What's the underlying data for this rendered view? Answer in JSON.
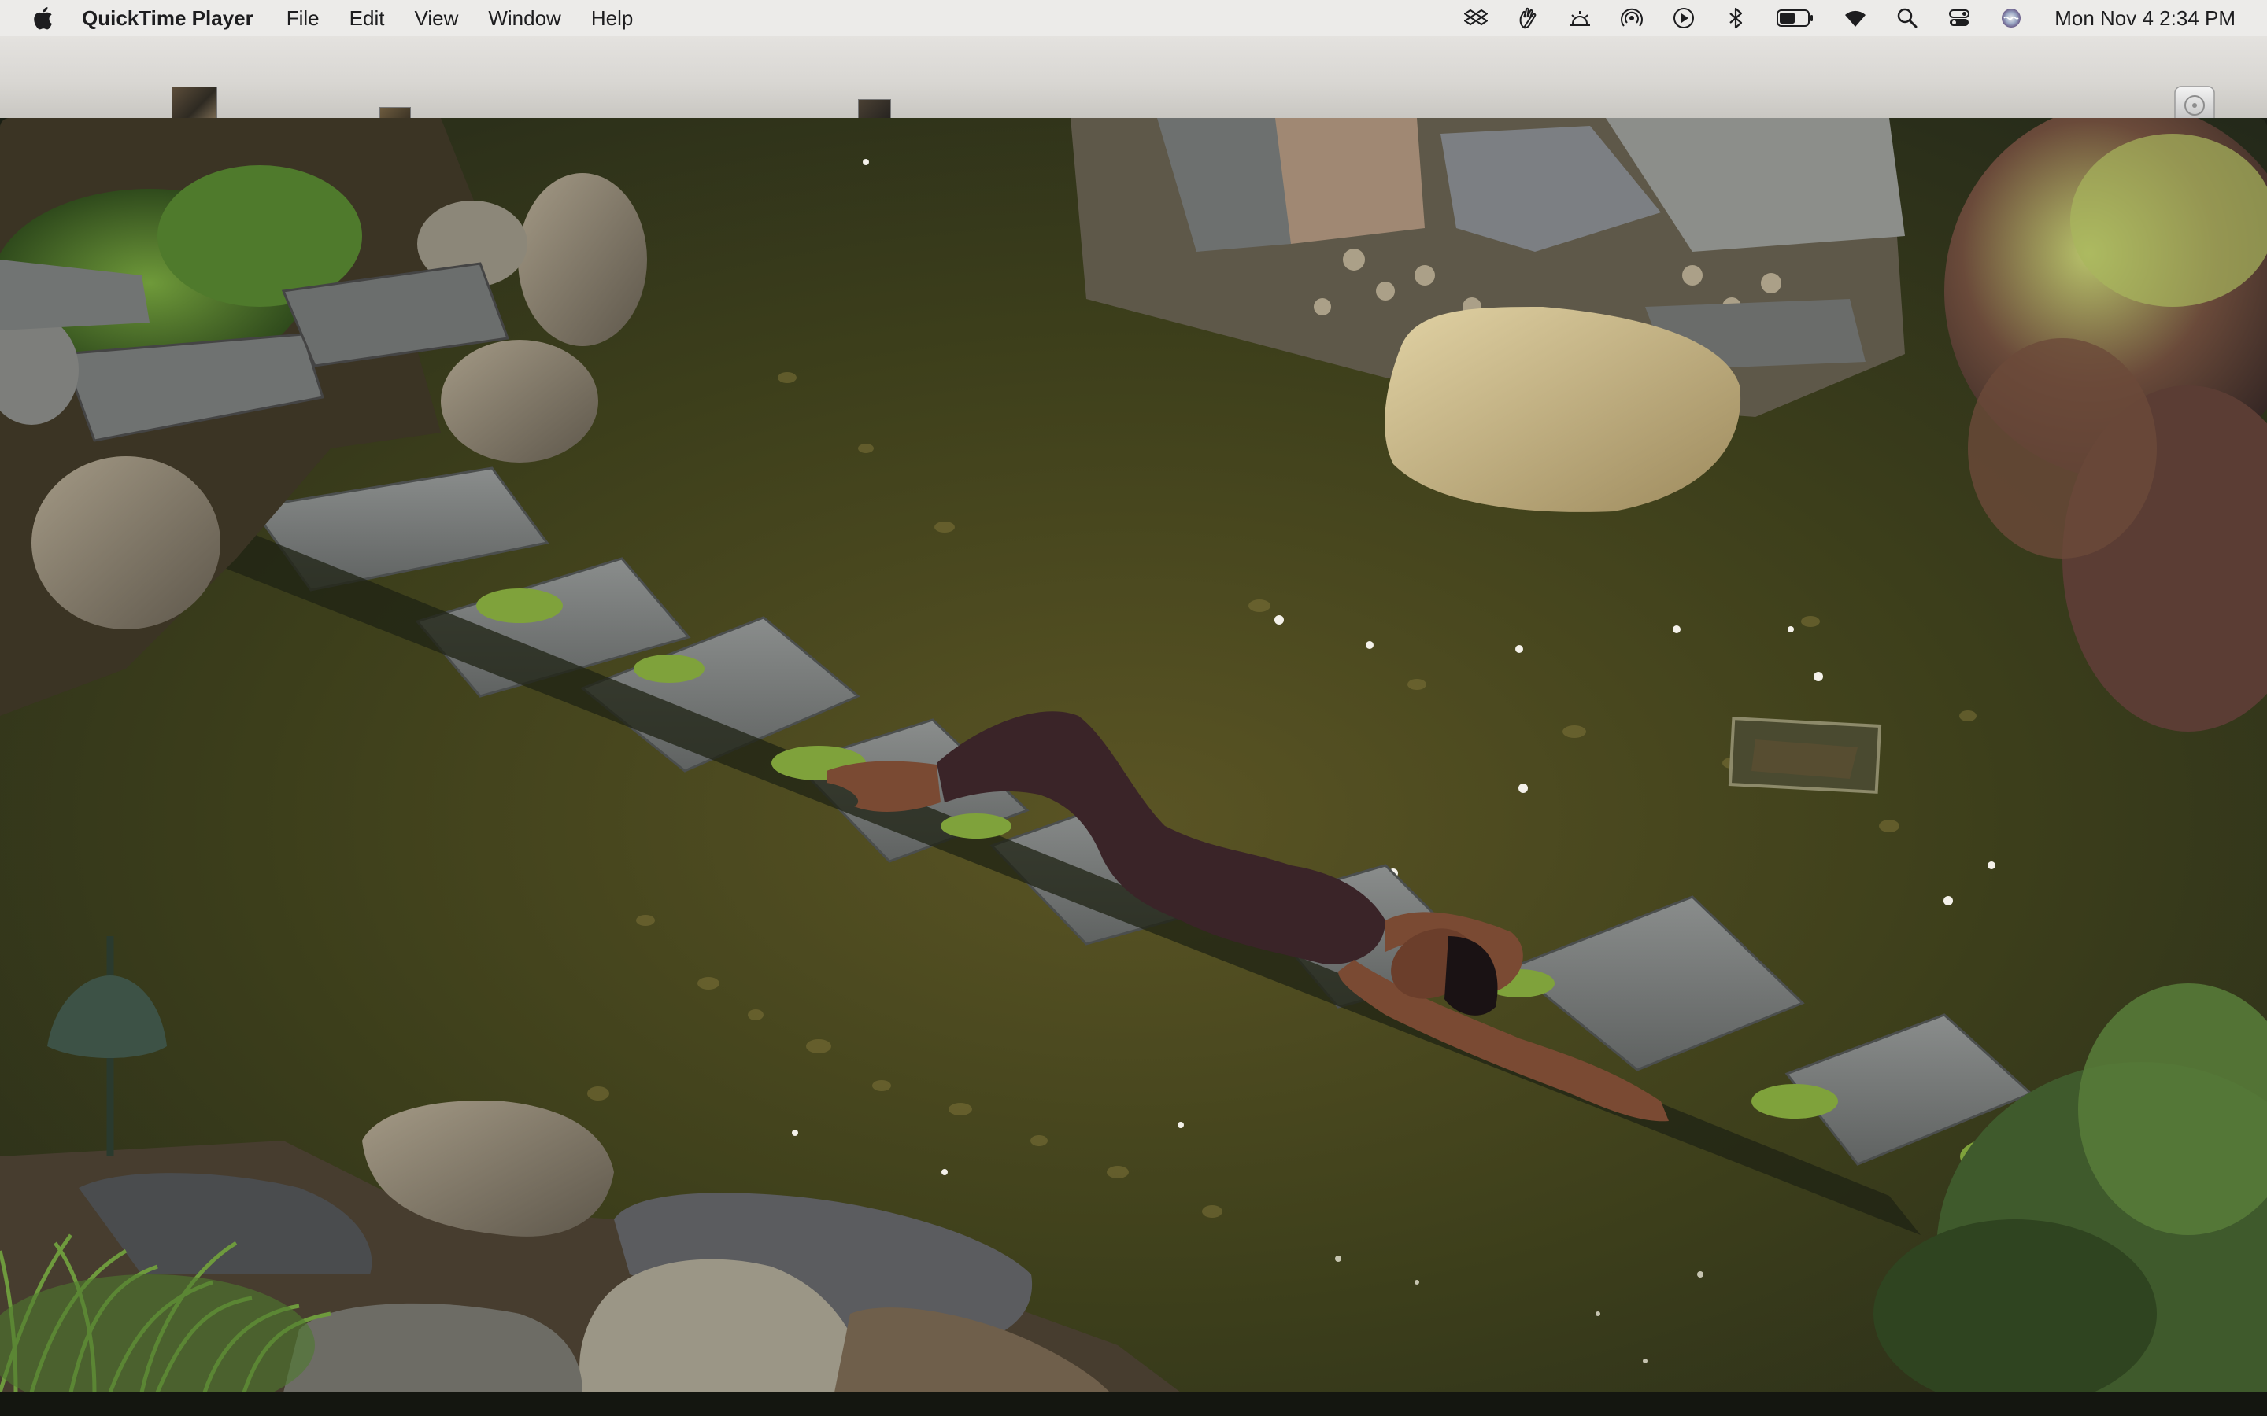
{
  "menubar": {
    "app_name": "QuickTime Player",
    "menus": [
      "File",
      "Edit",
      "View",
      "Window",
      "Help"
    ],
    "status_icons": [
      "dropbox-icon",
      "hand-icon",
      "sun-brightness-icon",
      "airdrop-icon",
      "play-circle-icon",
      "bluetooth-icon",
      "battery-icon",
      "wifi-icon",
      "spotlight-search-icon",
      "control-center-icon",
      "siri-icon"
    ],
    "clock": "Mon Nov 4  2:34 PM"
  },
  "desktop": {
    "disk_icon": "external-disk-icon"
  },
  "player": {
    "content": "video-frame",
    "colors": {
      "water": "#3b3f1c",
      "stone": "#7d8080",
      "dress": "#3a2428"
    }
  }
}
